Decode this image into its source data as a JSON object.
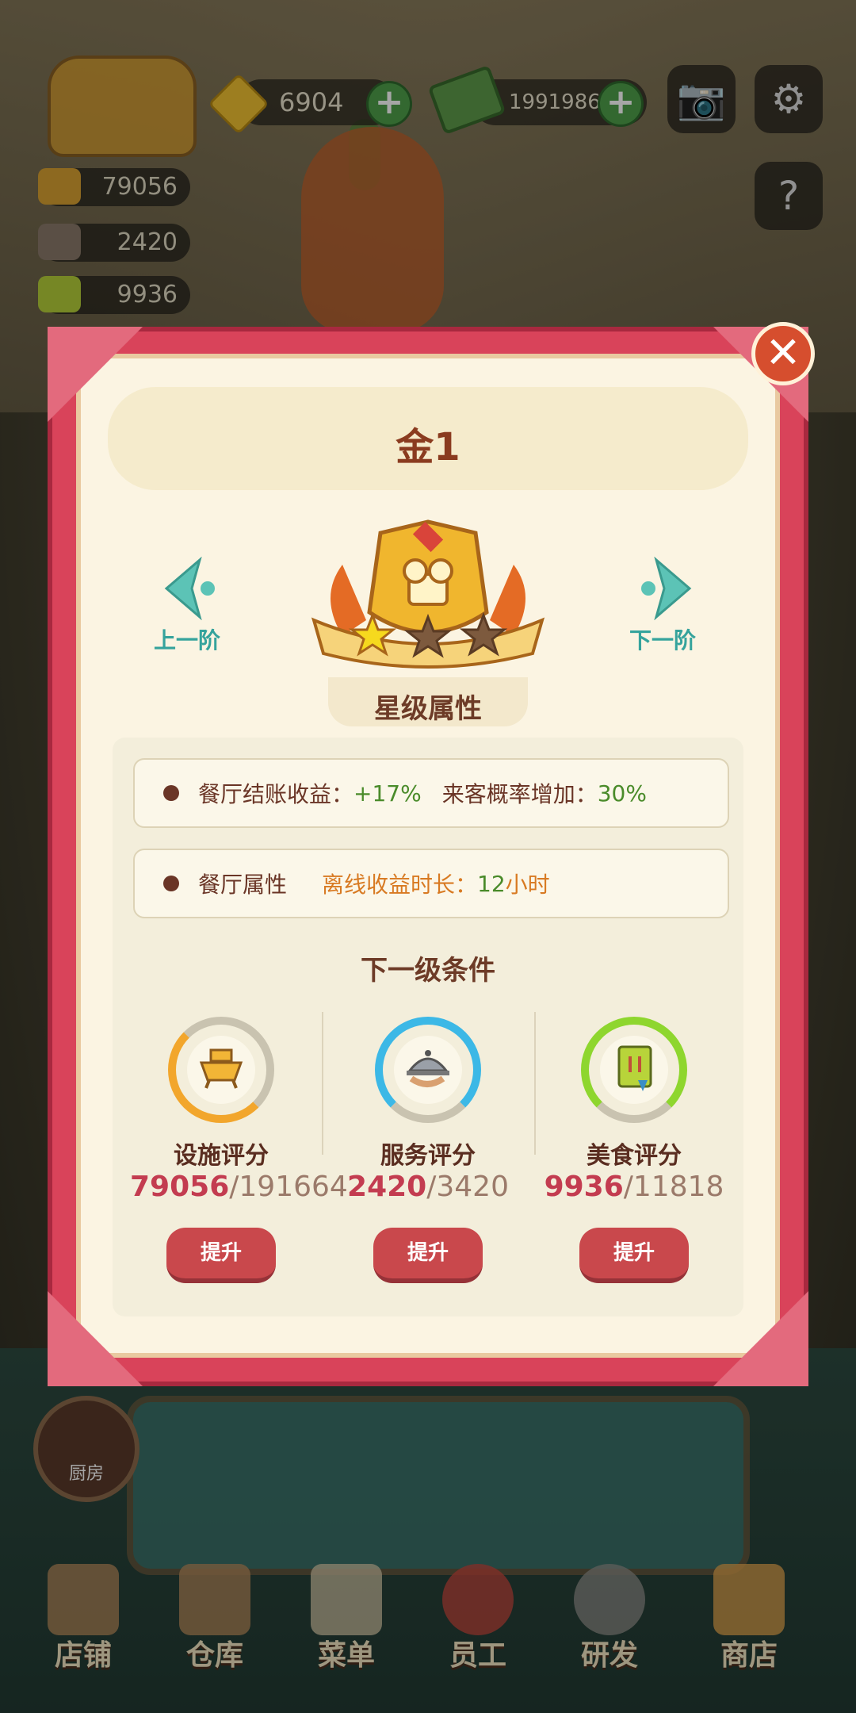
{
  "hud": {
    "gems": "6904",
    "cash": "19919865",
    "facility_score": "79056",
    "service_score": "2420",
    "food_score": "9936"
  },
  "modal": {
    "title": "金1",
    "prev_tier": "上一阶",
    "next_tier": "下一阶",
    "stars_filled": 1,
    "stars_total": 3,
    "attributes_title": "星级属性",
    "attr_row1_label": "餐厅结账收益：",
    "attr_row1_value": "+17%",
    "attr_row1_label2": "来客概率增加：",
    "attr_row1_value2": "30%",
    "attr_row2_label": "餐厅属性",
    "attr_row2_key": "离线收益时长：",
    "attr_row2_value": "12",
    "attr_row2_unit": "小时",
    "next_level_title": "下一级条件",
    "conditions": [
      {
        "label": "设施评分",
        "current": "79056",
        "sep": "/",
        "target": "191664",
        "button": "提升",
        "ring_color": "#f2a62c"
      },
      {
        "label": "服务评分",
        "current": "2420",
        "sep": "/",
        "target": "3420",
        "button": "提升",
        "ring_color": "#3cb8e6"
      },
      {
        "label": "美食评分",
        "current": "9936",
        "sep": "/",
        "target": "11818",
        "button": "提升",
        "ring_color": "#8ed62e"
      }
    ]
  },
  "bottom": {
    "kitchen": "厨房",
    "nav": [
      "店铺",
      "仓库",
      "菜单",
      "员工",
      "研发",
      "商店"
    ]
  }
}
